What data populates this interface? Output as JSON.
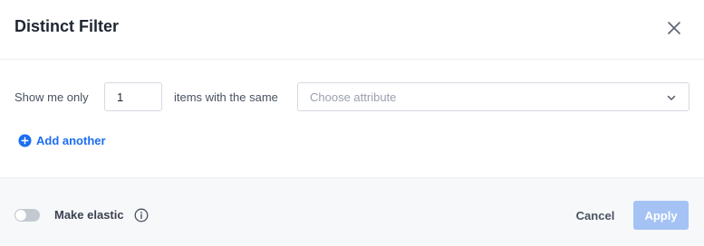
{
  "dialog": {
    "title": "Distinct Filter",
    "close_icon": "close-icon"
  },
  "filter": {
    "prefix_label": "Show me only",
    "count_value": "1",
    "middle_label": "items with the same",
    "attribute_placeholder": "Choose attribute",
    "dropdown_icon": "chevron-down-icon"
  },
  "add_another": {
    "label": "Add another",
    "icon": "plus-circle-icon"
  },
  "footer": {
    "elastic_label": "Make elastic",
    "elastic_enabled": false,
    "info_icon": "info-icon",
    "cancel_label": "Cancel",
    "apply_label": "Apply",
    "apply_disabled": true
  },
  "colors": {
    "accent": "#1b6ef3",
    "apply_disabled_bg": "#a4c2f4",
    "footer_bg": "#f7f8fa",
    "toggle_off": "#c4c9d1"
  }
}
